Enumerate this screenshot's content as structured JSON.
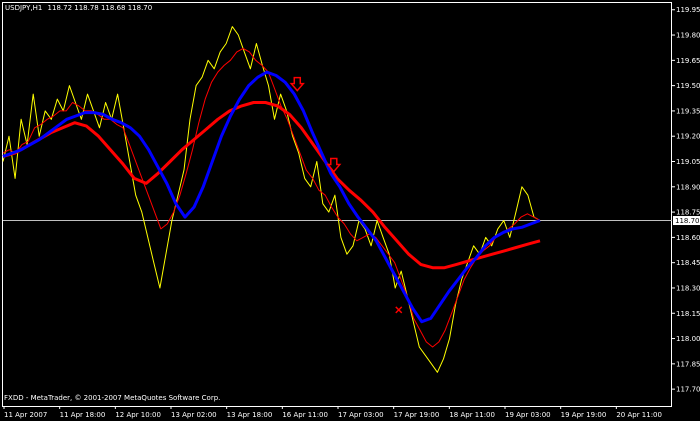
{
  "header": {
    "symbol": "USDJPY,H1",
    "quotes": "118.72 118.78 118.68 118.70"
  },
  "footer": {
    "copyright": "FXDD - MetaTrader, © 2001-2007 MetaQuotes Software Corp."
  },
  "colors": {
    "background": "#000000",
    "frame": "#ffffff",
    "price": "#ffff00",
    "fast_ma": "#ff0000",
    "mid_ma": "#0000ff",
    "slow_ma": "#ff0000",
    "last_price_line": "#c0c0c0",
    "price_box_bg": "#ffffff",
    "price_box_text": "#000000"
  },
  "chart_data": {
    "type": "line",
    "title": "USDJPY,H1",
    "ylim": [
      117.6,
      119.99
    ],
    "y_ticks": [
      119.95,
      119.8,
      119.65,
      119.5,
      119.35,
      119.2,
      119.05,
      118.9,
      118.75,
      118.6,
      118.45,
      118.3,
      118.15,
      118.0,
      117.85,
      117.7
    ],
    "y_tick_labels": [
      "119.95",
      "119.80",
      "119.65",
      "119.50",
      "119.35",
      "119.20",
      "119.05",
      "118.90",
      "118.75",
      "118.60",
      "118.45",
      "118.30",
      "118.15",
      "118.00",
      "117.85",
      "117.70"
    ],
    "x_labels": [
      "11 Apr 2007",
      "11 Apr 18:00",
      "12 Apr 10:00",
      "13 Apr 02:00",
      "13 Apr 18:00",
      "16 Apr 11:00",
      "17 Apr 03:00",
      "17 Apr 19:00",
      "18 Apr 11:00",
      "19 Apr 03:00",
      "19 Apr 19:00",
      "20 Apr 11:00"
    ],
    "current_price": 118.7,
    "current_price_label": "118.70",
    "grid": false,
    "series": [
      {
        "role": "price",
        "values": [
          119.05,
          119.2,
          118.95,
          119.3,
          119.15,
          119.45,
          119.2,
          119.35,
          119.3,
          119.42,
          119.35,
          119.5,
          119.4,
          119.3,
          119.45,
          119.35,
          119.25,
          119.4,
          119.3,
          119.45,
          119.25,
          119.05,
          118.85,
          118.75,
          118.6,
          118.45,
          118.3,
          118.5,
          118.7,
          118.85,
          119.0,
          119.3,
          119.5,
          119.55,
          119.65,
          119.6,
          119.7,
          119.75,
          119.85,
          119.8,
          119.7,
          119.6,
          119.75,
          119.62,
          119.5,
          119.3,
          119.45,
          119.35,
          119.2,
          119.1,
          118.95,
          118.9,
          119.05,
          118.8,
          118.75,
          118.85,
          118.6,
          118.5,
          118.55,
          118.7,
          118.65,
          118.55,
          118.7,
          118.6,
          118.5,
          118.3,
          118.4,
          118.25,
          118.1,
          117.95,
          117.9,
          117.85,
          117.8,
          117.88,
          118.0,
          118.2,
          118.35,
          118.45,
          118.55,
          118.5,
          118.6,
          118.55,
          118.65,
          118.7,
          118.6,
          118.75,
          118.9,
          118.85,
          118.72,
          118.7
        ]
      },
      {
        "role": "fast_ma",
        "values": [
          119.1,
          119.12,
          119.1,
          119.15,
          119.17,
          119.25,
          119.27,
          119.3,
          119.32,
          119.35,
          119.35,
          119.4,
          119.38,
          119.35,
          119.35,
          119.33,
          119.3,
          119.3,
          119.27,
          119.25,
          119.15,
          119.05,
          118.95,
          118.85,
          118.75,
          118.65,
          118.68,
          118.75,
          118.85,
          118.98,
          119.12,
          119.28,
          119.42,
          119.52,
          119.58,
          119.62,
          119.65,
          119.7,
          119.72,
          119.7,
          119.65,
          119.62,
          119.58,
          119.48,
          119.38,
          119.3,
          119.2,
          119.1,
          119.0,
          118.95,
          118.88,
          118.85,
          118.78,
          118.72,
          118.68,
          118.62,
          118.58,
          118.6,
          118.62,
          118.6,
          118.55,
          118.5,
          118.45,
          118.35,
          118.25,
          118.12,
          118.05,
          117.98,
          117.95,
          117.98,
          118.05,
          118.15,
          118.25,
          118.35,
          118.42,
          118.48,
          118.52,
          118.55,
          118.6,
          118.62,
          118.65,
          118.68,
          118.72,
          118.74,
          118.72,
          118.7
        ]
      },
      {
        "role": "mid_ma",
        "values": [
          119.08,
          119.1,
          119.12,
          119.15,
          119.18,
          119.22,
          119.26,
          119.3,
          119.32,
          119.34,
          119.34,
          119.33,
          119.3,
          119.28,
          119.25,
          119.2,
          119.12,
          119.02,
          118.92,
          118.8,
          118.72,
          118.78,
          118.9,
          119.05,
          119.2,
          119.32,
          119.42,
          119.5,
          119.55,
          119.58,
          119.56,
          119.52,
          119.45,
          119.35,
          119.22,
          119.1,
          118.98,
          118.9,
          118.8,
          118.72,
          118.65,
          118.58,
          118.48,
          118.38,
          118.28,
          118.18,
          118.1,
          118.12,
          118.2,
          118.28,
          118.35,
          118.42,
          118.48,
          118.55,
          118.6,
          118.63,
          118.65,
          118.66,
          118.68,
          118.7
        ]
      },
      {
        "role": "slow_ma",
        "values": [
          119.08,
          119.1,
          119.14,
          119.18,
          119.22,
          119.25,
          119.28,
          119.26,
          119.2,
          119.12,
          119.04,
          118.95,
          118.92,
          118.98,
          119.05,
          119.12,
          119.18,
          119.24,
          119.3,
          119.35,
          119.38,
          119.4,
          119.4,
          119.38,
          119.33,
          119.25,
          119.15,
          119.05,
          118.95,
          118.88,
          118.82,
          118.75,
          118.66,
          118.58,
          118.5,
          118.44,
          118.42,
          118.42,
          118.44,
          118.46,
          118.48,
          118.5,
          118.52,
          118.54,
          118.56,
          118.58
        ]
      }
    ],
    "signals": [
      {
        "kind": "sell-arrow",
        "x_index": 0.548,
        "value": 119.5
      },
      {
        "kind": "sell-arrow",
        "x_index": 0.616,
        "value": 119.02
      },
      {
        "kind": "buy-x",
        "x_index": 0.737,
        "value": 118.17
      }
    ]
  }
}
